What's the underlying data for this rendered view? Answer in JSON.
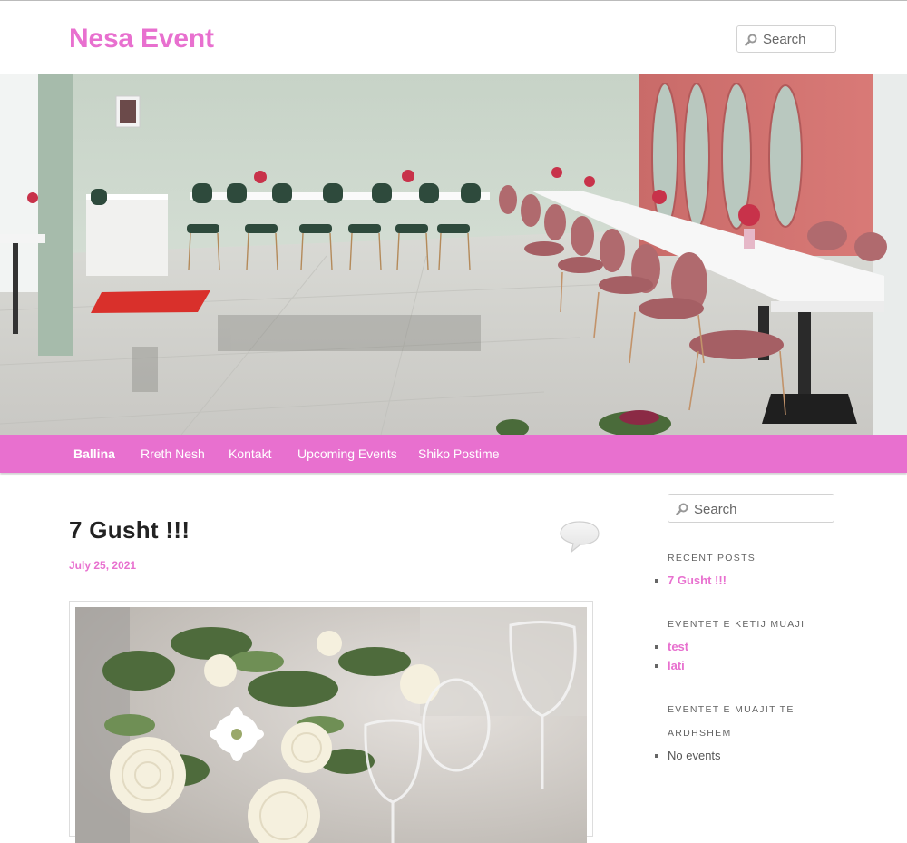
{
  "site": {
    "title": "Nesa Event"
  },
  "header": {
    "search_placeholder": "Search"
  },
  "nav": {
    "items": [
      {
        "label": "Ballina",
        "active": true
      },
      {
        "label": "Rreth Nesh",
        "active": false
      },
      {
        "label": "Kontakt",
        "active": false
      },
      {
        "label": "Upcoming Events",
        "active": false
      },
      {
        "label": "Shiko Postime",
        "active": false
      }
    ]
  },
  "post": {
    "title": "7 Gusht !!!",
    "date": "July 25, 2021"
  },
  "sidebar": {
    "search_placeholder": "Search",
    "recent_posts": {
      "title": "RECENT POSTS",
      "items": [
        "7 Gusht !!!"
      ]
    },
    "this_month": {
      "title": "EVENTET E KETIJ MUAJI",
      "items": [
        "test",
        "lati"
      ]
    },
    "next_month": {
      "title_line1": "EVENTET E MUAJIT TE",
      "title_line2": "ARDHSHEM",
      "items": [
        "No events"
      ]
    }
  },
  "colors": {
    "accent": "#e870cf",
    "nav_bg": "#e870cf",
    "title_text": "#222222"
  },
  "icons": [
    "search-icon",
    "comment-bubble-icon"
  ]
}
